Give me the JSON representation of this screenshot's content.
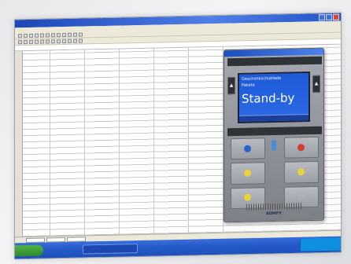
{
  "display": {
    "line1": "Geschenkschublade",
    "line2": "Pakete",
    "status": "Stand-by"
  },
  "brand": "SOMFY",
  "colors": {
    "lcd_blue": "#2c6ae6",
    "taskbar_blue": "#245ac9",
    "key_blue": "#2a62c9",
    "key_red": "#d23c30",
    "key_yellow": "#e8d43a"
  },
  "keys": [
    {
      "icon": "blue-light-icon",
      "color": "#2a62c9"
    },
    {
      "icon": "red-light-icon",
      "color": "#d23c30"
    },
    {
      "icon": "yellow-light-icon",
      "color": "#e8d43a"
    },
    {
      "icon": "yellow-light-icon",
      "color": "#e8d43a"
    },
    {
      "icon": "yellow-light-icon",
      "color": "#e8d43a"
    },
    {
      "icon": "blank-key-icon",
      "color": "#aeb1b7"
    }
  ]
}
